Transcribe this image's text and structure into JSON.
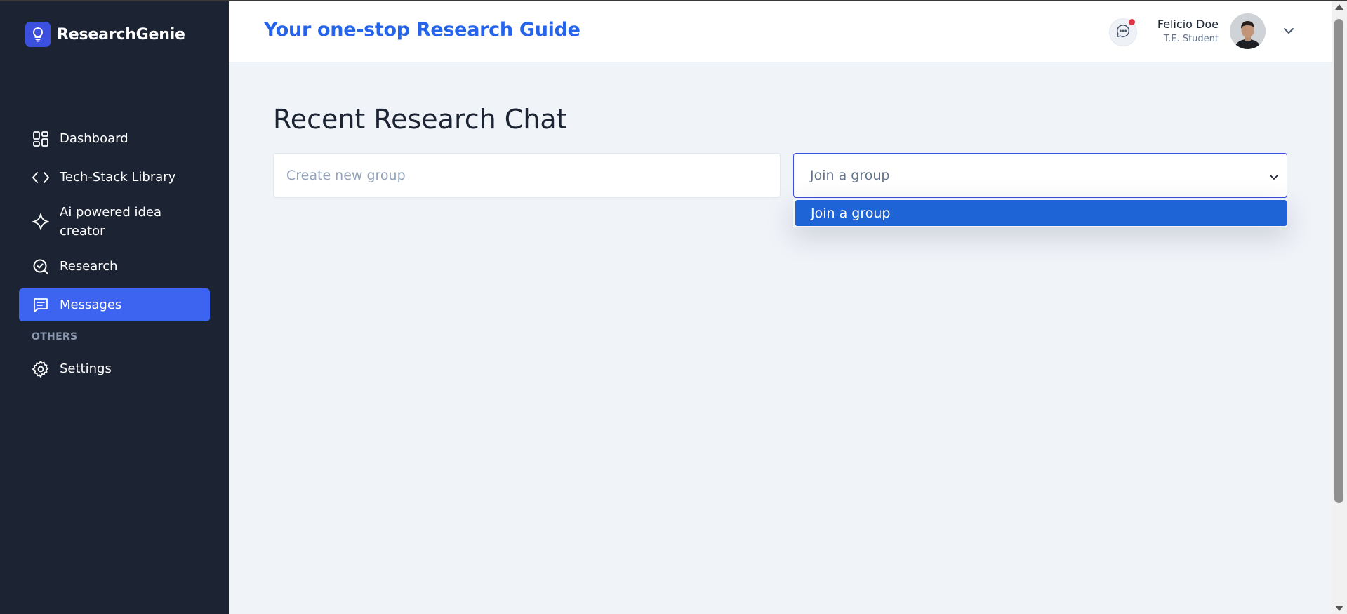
{
  "brand": {
    "name": "ResearchGenie",
    "icon": "lightbulb-icon"
  },
  "sidebar": {
    "items": [
      {
        "label": "Dashboard",
        "icon": "dashboard-grid-icon",
        "active": false
      },
      {
        "label": "Tech-Stack Library",
        "icon": "code-icon",
        "active": false
      },
      {
        "label": "Ai powered idea creator",
        "icon": "sparkle-icon",
        "active": false
      },
      {
        "label": "Research",
        "icon": "search-check-icon",
        "active": false
      },
      {
        "label": "Messages",
        "icon": "message-icon",
        "active": true
      }
    ],
    "section_label": "OTHERS",
    "other_items": [
      {
        "label": "Settings",
        "icon": "gear-icon",
        "active": false
      }
    ]
  },
  "header": {
    "tagline": "Your one-stop Research Guide",
    "user": {
      "name": "Felicio Doe",
      "role": "T.E. Student"
    },
    "notification_icon": "chat-bubble-icon",
    "has_notification": true
  },
  "main": {
    "title": "Recent Research Chat",
    "create_group": {
      "placeholder": "Create new group",
      "value": ""
    },
    "join_group": {
      "selected": "Join a group",
      "options": [
        "Join a group"
      ]
    }
  },
  "colors": {
    "sidebar_bg": "#1c2434",
    "accent": "#3c64f0",
    "tagline": "#2563eb",
    "dropdown_highlight": "#1f64d6",
    "page_bg": "#f0f3f8"
  }
}
